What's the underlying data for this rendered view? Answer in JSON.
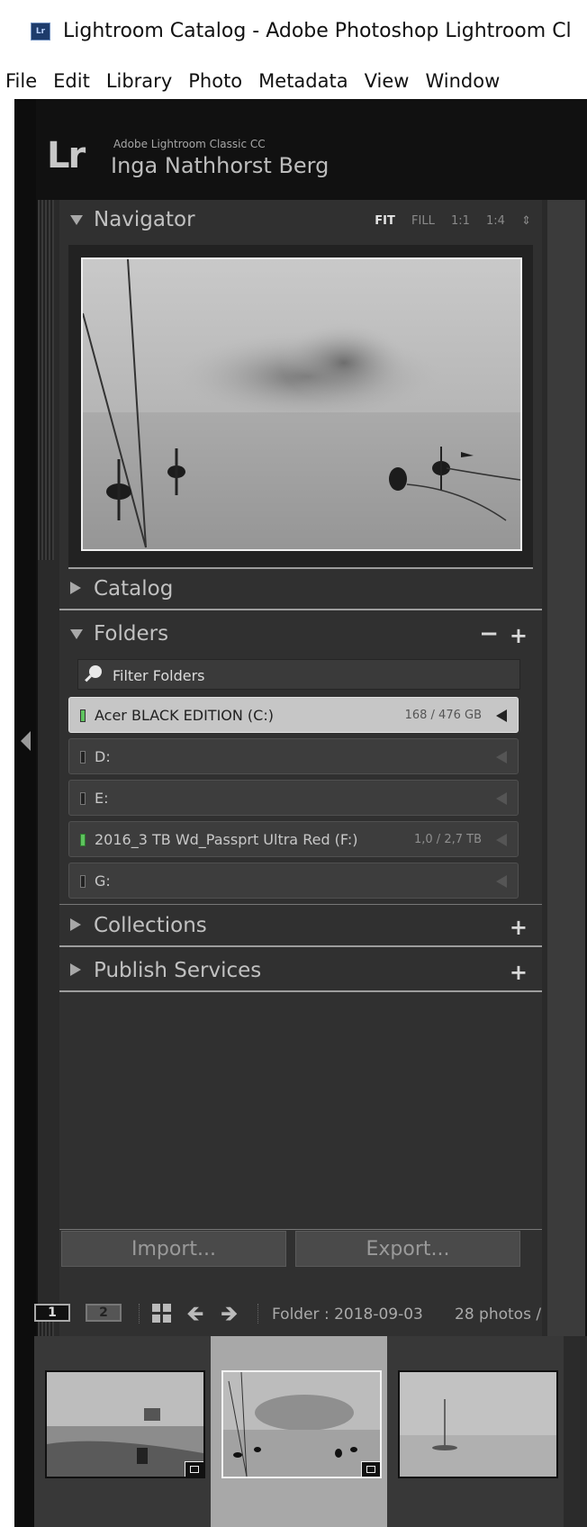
{
  "window": {
    "icon_text": "Lr",
    "title": "Lightroom Catalog - Adobe Photoshop Lightroom Cl"
  },
  "menubar": [
    "File",
    "Edit",
    "Library",
    "Photo",
    "Metadata",
    "View",
    "Window"
  ],
  "identity": {
    "logo": "Lr",
    "product": "Adobe Lightroom Classic CC",
    "name": "Inga Nathhorst Berg"
  },
  "navigator": {
    "label": "Navigator",
    "zoom_options": [
      {
        "label": "FIT",
        "active": true
      },
      {
        "label": "FILL",
        "active": false
      },
      {
        "label": "1:1",
        "active": false
      },
      {
        "label": "1:4",
        "active": false
      }
    ],
    "zoom_stepper": "⇕"
  },
  "panels": {
    "catalog": "Catalog",
    "folders": "Folders",
    "collections": "Collections",
    "publish_services": "Publish Services"
  },
  "folders": {
    "filter_placeholder": "Filter Folders",
    "volumes": [
      {
        "name": "Acer BLACK EDITION (C:)",
        "size": "168 / 476 GB",
        "online": true,
        "selected": true
      },
      {
        "name": "D:",
        "size": "",
        "online": false,
        "selected": false
      },
      {
        "name": "E:",
        "size": "",
        "online": false,
        "selected": false
      },
      {
        "name": "2016_3 TB Wd_Passprt Ultra Red (F:)",
        "size": "1,0 / 2,7 TB",
        "online": true,
        "selected": false
      },
      {
        "name": "G:",
        "size": "",
        "online": false,
        "selected": false
      }
    ]
  },
  "buttons": {
    "import": "Import...",
    "export": "Export..."
  },
  "filmstrip": {
    "monitor_1": "1",
    "monitor_2": "2",
    "folder": "Folder : 2018-09-03",
    "count": "28 photos /"
  },
  "icons": {
    "minus": "minus-icon",
    "plus": "plus-icon",
    "grid": "grid-icon",
    "back": "arrow-left-icon",
    "forward": "arrow-right-icon",
    "filter": "magnifier-icon"
  },
  "colors": {
    "panel_bg": "#303030",
    "app_bg": "#111111",
    "selected_volume": "#c6c6c6",
    "online_led": "#5ec35e"
  }
}
